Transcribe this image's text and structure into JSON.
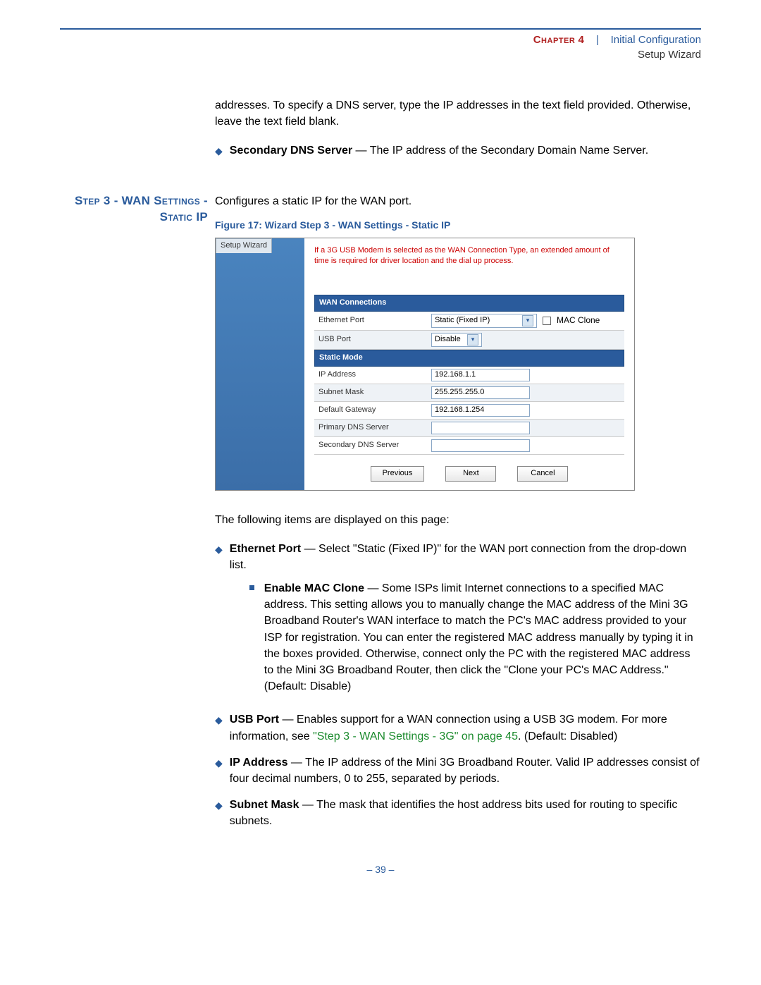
{
  "header": {
    "chapter_word": "Chapter",
    "chapter_num": "4",
    "divider": "|",
    "chapter_title": "Initial Configuration",
    "subtitle": "Setup Wizard"
  },
  "intro_continued": "addresses. To specify a DNS server, type the IP addresses in the text field provided. Otherwise, leave the text field blank.",
  "bullet_secondary_dns": {
    "label": "Secondary DNS Server",
    "text": " — The IP address of the Secondary Domain Name Server."
  },
  "section_heading": "Step 3 - WAN Settings - Static IP",
  "section_intro": "Configures a static IP for the WAN port.",
  "figure_caption": "Figure 17:  Wizard Step 3 - WAN Settings - Static IP",
  "wizard": {
    "tab": "Setup Wizard",
    "note": "If a 3G USB Modem is selected as the WAN Connection Type, an extended amount of time is required for driver location and the dial up process.",
    "sections": {
      "wan_connections": "WAN Connections",
      "static_mode": "Static Mode"
    },
    "rows": {
      "ethernet_port": {
        "label": "Ethernet Port",
        "value": "Static (Fixed IP)",
        "mac_clone": "MAC Clone"
      },
      "usb_port": {
        "label": "USB Port",
        "value": "Disable"
      },
      "ip_address": {
        "label": "IP Address",
        "value": "192.168.1.1"
      },
      "subnet_mask": {
        "label": "Subnet Mask",
        "value": "255.255.255.0"
      },
      "default_gateway": {
        "label": "Default Gateway",
        "value": "192.168.1.254"
      },
      "primary_dns": {
        "label": "Primary DNS Server",
        "value": ""
      },
      "secondary_dns": {
        "label": "Secondary DNS Server",
        "value": ""
      }
    },
    "buttons": {
      "previous": "Previous",
      "next": "Next",
      "cancel": "Cancel"
    }
  },
  "post_figure_intro": "The following items are displayed on this page:",
  "bullets": {
    "ethernet_port": {
      "label": "Ethernet Port",
      "text": " — Select \"Static (Fixed IP)\" for the WAN port connection from the drop-down list."
    },
    "mac_clone": {
      "label": "Enable MAC Clone",
      "text": " — Some ISPs limit Internet connections to a specified MAC address. This setting allows you to manually change the MAC address of the Mini 3G Broadband Router's WAN interface to match the PC's MAC address provided to your ISP for registration. You can enter the registered MAC address manually by typing it in the boxes provided. Otherwise, connect only the PC with the registered MAC address to the Mini 3G Broadband Router, then click the \"Clone your PC's MAC Address.\" (Default: Disable)"
    },
    "usb_port": {
      "label": "USB Port",
      "text_a": " — Enables support for a WAN connection using a USB 3G modem. For more information, see ",
      "link": "\"Step 3 - WAN Settings - 3G\" on page 45",
      "text_b": ". (Default: Disabled)"
    },
    "ip_address": {
      "label": "IP Address",
      "text": " — The IP address of the Mini 3G Broadband Router. Valid IP addresses consist of four decimal numbers, 0 to 255, separated by periods."
    },
    "subnet_mask": {
      "label": "Subnet Mask",
      "text": " — The mask that identifies the host address bits used for routing to specific subnets."
    }
  },
  "page_number": "– 39 –"
}
